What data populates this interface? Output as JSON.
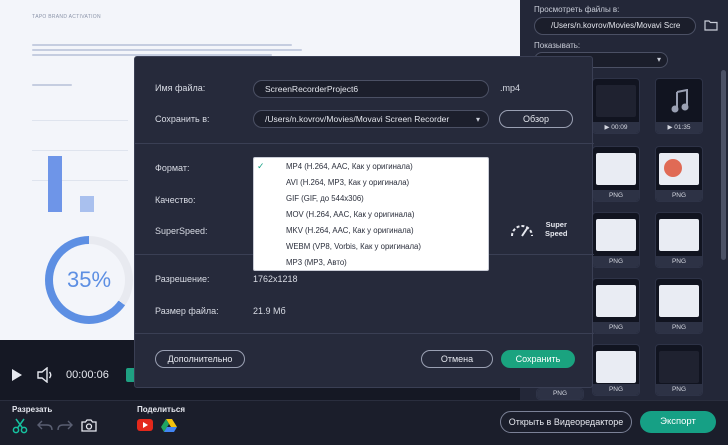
{
  "preview": {
    "heading": "ТАРО BRAND ACTIVATION",
    "donut_percent": "35%"
  },
  "side": {
    "view_files_label": "Просмотреть файлы в:",
    "path": "/Users/n.kovrov/Movies/Movavi Scre",
    "show_label": "Показывать:",
    "thumbs": [
      {
        "caption": "▶ 00:09"
      },
      {
        "caption": "▶ 01:35"
      },
      {
        "caption": "PNG"
      },
      {
        "caption": "PNG"
      },
      {
        "caption": "PNG"
      },
      {
        "caption": "PNG"
      },
      {
        "caption": "PNG"
      },
      {
        "caption": "PNG"
      },
      {
        "caption": "PNG"
      },
      {
        "caption": "PNG"
      },
      {
        "caption": "PNG"
      },
      {
        "caption": "PNG"
      },
      {
        "caption": "PNG"
      }
    ]
  },
  "player": {
    "time": "00:00:06"
  },
  "toolbar": {
    "cut_label": "Разрезать",
    "share_label": "Поделиться",
    "open_editor_label": "Открыть в Видеоредакторе",
    "export_label": "Экспорт"
  },
  "dialog": {
    "filename_label": "Имя файла:",
    "filename_value": "ScreenRecorderProject6",
    "extension": ".mp4",
    "save_to_label": "Сохранить в:",
    "save_to_value": "/Users/n.kovrov/Movies/Movavi Screen Recorder",
    "browse_label": "Обзор",
    "format_label": "Формат:",
    "quality_label": "Качество:",
    "superspeed_label": "SuperSpeed:",
    "superspeed_badge_1": "Super",
    "superspeed_badge_2": "Speed",
    "resolution_label": "Разрешение:",
    "resolution_value": "1762x1218",
    "filesize_label": "Размер файла:",
    "filesize_value": "21.9 Мб",
    "more_label": "Дополнительно",
    "cancel_label": "Отмена",
    "save_label": "Сохранить",
    "format_options": [
      {
        "label": "MP4 (H.264, AAC, Как у оригинала)",
        "selected": true
      },
      {
        "label": "AVI (H.264, MP3, Как у оригинала)",
        "selected": false
      },
      {
        "label": "GIF (GIF, до 544x306)",
        "selected": false
      },
      {
        "label": "MOV (H.264, AAC, Как у оригинала)",
        "selected": false
      },
      {
        "label": "MKV (H.264, AAC, Как у оригинала)",
        "selected": false
      },
      {
        "label": "WEBM (VP8, Vorbis, Как у оригинала)",
        "selected": false
      },
      {
        "label": "MP3 (MP3, Авто)",
        "selected": false
      }
    ]
  },
  "colors": {
    "accent": "#16a085",
    "panel": "#232738",
    "dialog": "#262a3b"
  }
}
